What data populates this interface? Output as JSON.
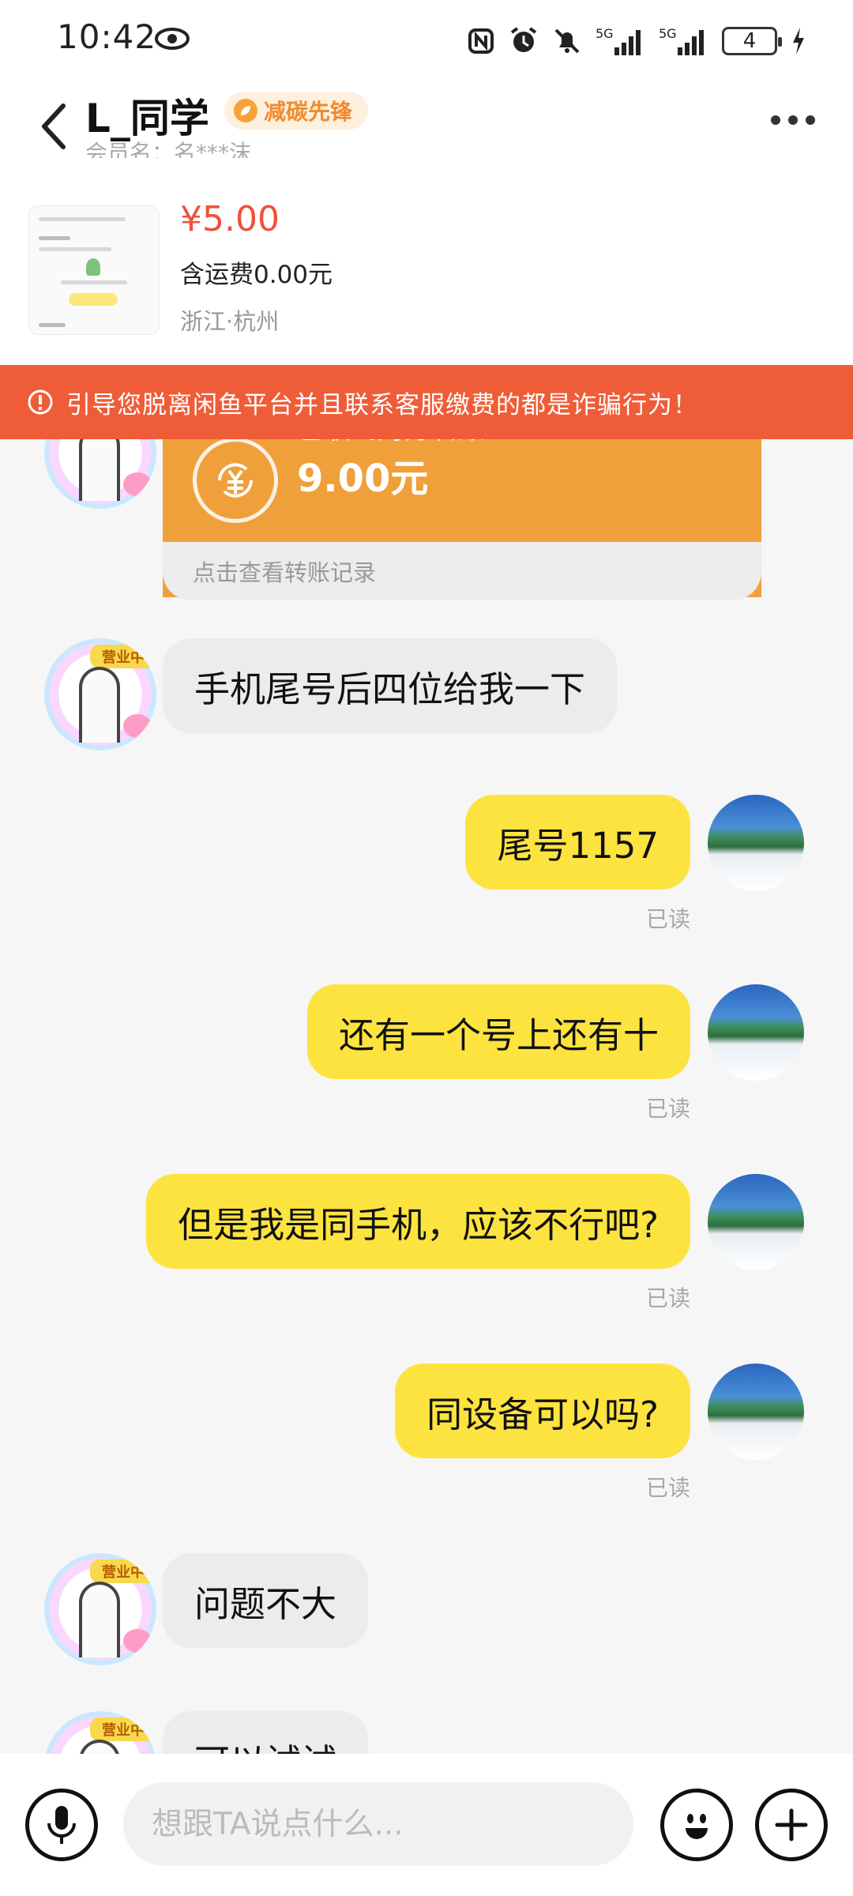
{
  "status_bar": {
    "time": "10:42",
    "signal_1": "5G",
    "signal_2": "5G",
    "battery": "4"
  },
  "header": {
    "user_name": "L_同学",
    "badge": "减碳先锋",
    "member_name": "会员名：名***沫"
  },
  "product": {
    "price": "¥5.00",
    "shipping": "含运费0.00元",
    "location": "浙江·杭州"
  },
  "warning": {
    "text": "引导您脱离闲鱼平台并且联系客服缴费的都是诈骗行为！"
  },
  "chat": {
    "transfer": {
      "title": "已收到对方转账",
      "amount": "9.00元",
      "footer": "点击查看转账记录"
    },
    "avatar_tag": "营业中",
    "messages": [
      {
        "side": "left",
        "text": "手机尾号后四位给我一下"
      },
      {
        "side": "right",
        "text": "尾号1157",
        "status": "已读"
      },
      {
        "side": "right",
        "text": "还有一个号上还有十",
        "status": "已读"
      },
      {
        "side": "right",
        "text": "但是我是同手机，应该不行吧?",
        "status": "已读"
      },
      {
        "side": "right",
        "text": "同设备可以吗?",
        "status": "已读"
      },
      {
        "side": "left",
        "text": "问题不大"
      },
      {
        "side": "left",
        "text": "可以试试"
      }
    ]
  },
  "input_bar": {
    "placeholder": "想跟TA说点什么..."
  },
  "colors": {
    "accent_yellow": "#fde33f",
    "warning_red": "#ef5d38",
    "price_red": "#f0503a",
    "transfer_orange": "#f0a03b"
  }
}
